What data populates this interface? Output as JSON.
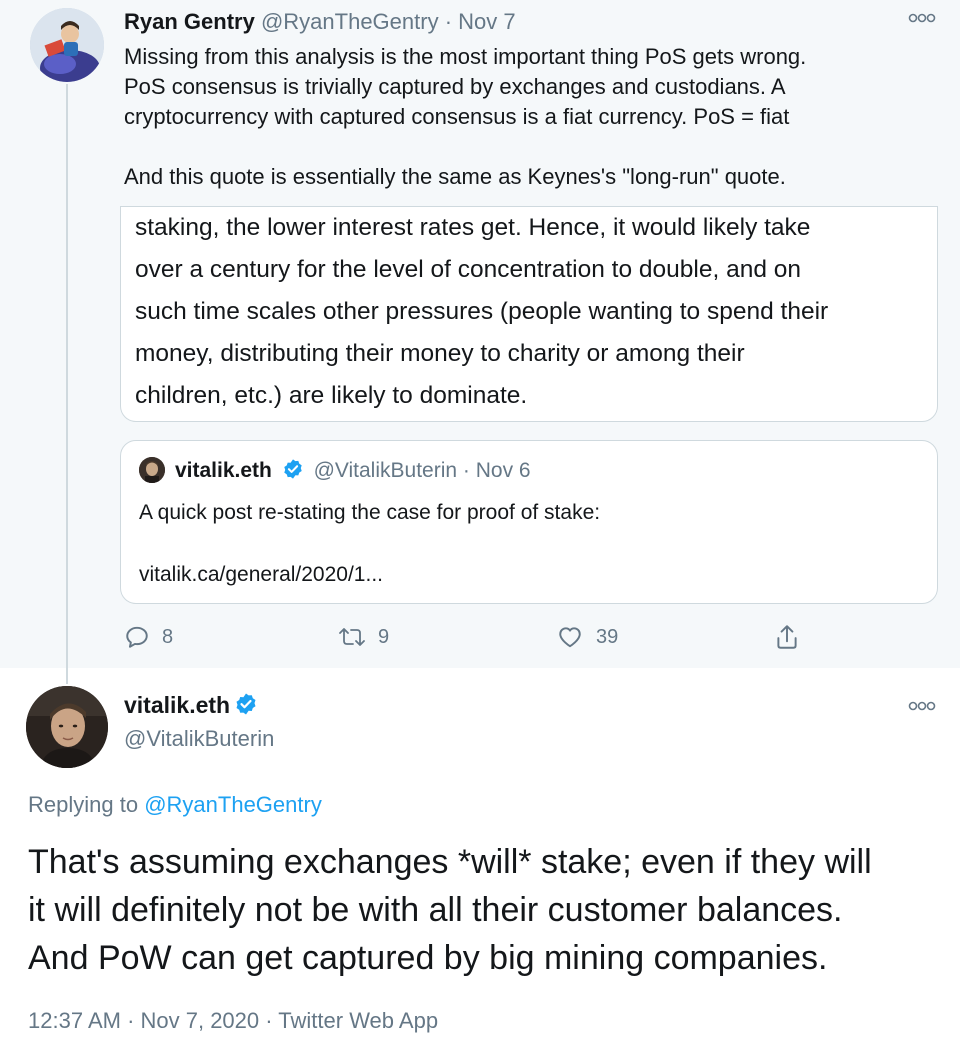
{
  "parent_tweet": {
    "author_name": "Ryan Gentry",
    "author_handle": "@RyanTheGentry",
    "separator": "·",
    "date": "Nov 7",
    "text_lines": [
      "Missing from this analysis is the most important thing PoS gets wrong.",
      "PoS consensus is trivially captured by exchanges and custodians. A",
      "cryptocurrency with captured consensus is a fiat currency. PoS = fiat",
      "And this quote is essentially the same as Keynes's \"long-run\" quote."
    ],
    "quoted_image_lines": [
      "staking, the lower interest rates get. Hence, it would likely take",
      "over a century for the level of concentration to double, and on",
      "such time scales other pressures (people wanting to spend their",
      "money, distributing their money to charity or among their",
      "children, etc.) are likely to dominate."
    ],
    "quoted_tweet": {
      "author_name": "vitalik.eth",
      "author_handle": "@VitalikButerin",
      "separator": "·",
      "date": "Nov 6",
      "text": "A quick post re-stating the case for proof of stake:",
      "link": "vitalik.ca/general/2020/1..."
    },
    "actions": {
      "replies": "8",
      "retweets": "9",
      "likes": "39"
    }
  },
  "main_tweet": {
    "author_name": "vitalik.eth",
    "author_handle": "@VitalikButerin",
    "replying_prefix": "Replying to",
    "replying_handle": "@RyanTheGentry",
    "text_lines": [
      "That's assuming exchanges *will* stake; even if they will",
      "it will definitely not be with all their customer balances.",
      "And PoW can get captured by big mining companies."
    ],
    "timestamp": "12:37 AM · Nov 7, 2020 · Twitter Web App"
  },
  "colors": {
    "accent": "#1da1f2",
    "muted": "#657786",
    "parent_background": "#f5f8fa"
  },
  "icons": [
    "more-icon",
    "verified-badge-icon",
    "reply-icon",
    "retweet-icon",
    "like-icon",
    "share-icon"
  ]
}
